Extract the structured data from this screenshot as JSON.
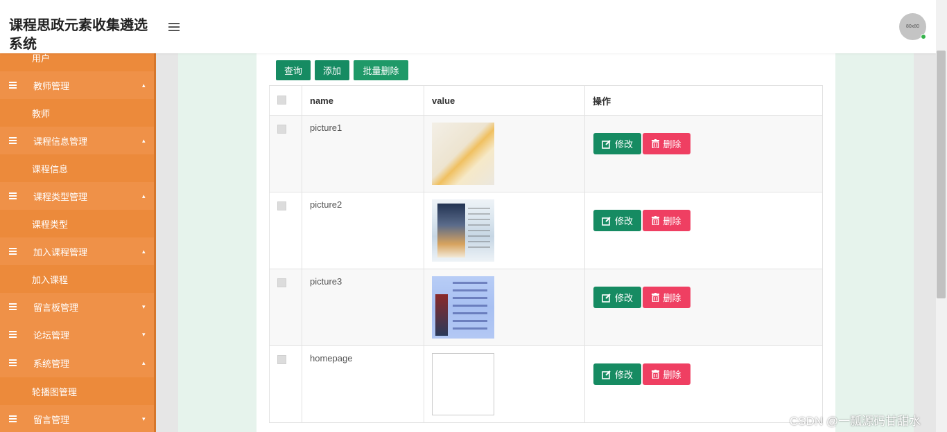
{
  "app": {
    "title": "课程思政元素收集遴选系统",
    "avatar_text": "80x80"
  },
  "sidebar": {
    "items": [
      {
        "type": "sub",
        "label": "用户",
        "partial": true
      },
      {
        "type": "group",
        "label": "教师管理",
        "arrow": "▴"
      },
      {
        "type": "sub",
        "label": "教师"
      },
      {
        "type": "group",
        "label": "课程信息管理",
        "arrow": "▴"
      },
      {
        "type": "sub",
        "label": "课程信息"
      },
      {
        "type": "group",
        "label": "课程类型管理",
        "arrow": "▴"
      },
      {
        "type": "sub",
        "label": "课程类型"
      },
      {
        "type": "group",
        "label": "加入课程管理",
        "arrow": "▴"
      },
      {
        "type": "sub",
        "label": "加入课程"
      },
      {
        "type": "group",
        "label": "留言板管理",
        "arrow": "▾"
      },
      {
        "type": "group",
        "label": "论坛管理",
        "arrow": "▾"
      },
      {
        "type": "group",
        "label": "系统管理",
        "arrow": "▴"
      },
      {
        "type": "sub",
        "label": "轮播图管理"
      },
      {
        "type": "group",
        "label": "留言管理",
        "arrow": "▾"
      }
    ]
  },
  "toolbar": {
    "query_label": "查询",
    "add_label": "添加",
    "batch_delete_label": "批量删除"
  },
  "table": {
    "columns": [
      "name",
      "value",
      "操作"
    ],
    "rows": [
      {
        "name": "picture1",
        "thumb": "thumb1"
      },
      {
        "name": "picture2",
        "thumb": "thumb2"
      },
      {
        "name": "picture3",
        "thumb": "thumb3"
      },
      {
        "name": "homepage",
        "thumb": "thumb4"
      }
    ],
    "edit_label": "修改",
    "delete_label": "删除"
  },
  "watermark": "CSDN @一瓢源码甘甜水",
  "colors": {
    "primary": "#168b62",
    "danger": "#ef3f62",
    "sidebar": "#ec8a3b"
  },
  "icons": {
    "edit": "edit-icon",
    "delete": "trash-icon",
    "menu": "list-icon"
  }
}
